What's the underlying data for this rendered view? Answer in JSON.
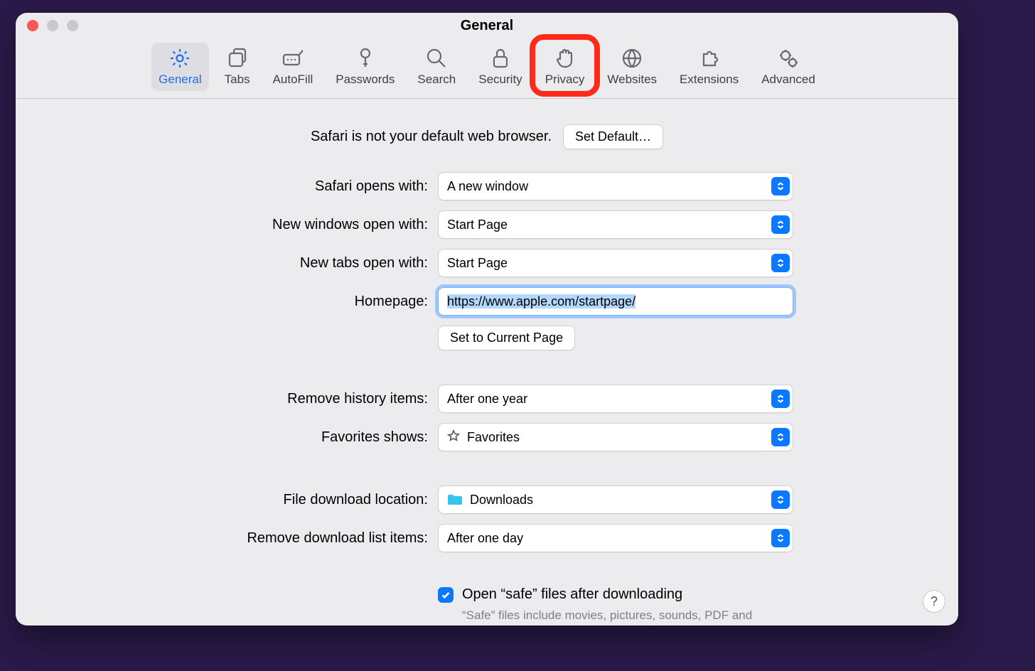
{
  "window": {
    "title": "General"
  },
  "tabs": [
    {
      "id": "general",
      "label": "General"
    },
    {
      "id": "tabs",
      "label": "Tabs"
    },
    {
      "id": "autofill",
      "label": "AutoFill"
    },
    {
      "id": "passwords",
      "label": "Passwords"
    },
    {
      "id": "search",
      "label": "Search"
    },
    {
      "id": "security",
      "label": "Security"
    },
    {
      "id": "privacy",
      "label": "Privacy"
    },
    {
      "id": "websites",
      "label": "Websites"
    },
    {
      "id": "extensions",
      "label": "Extensions"
    },
    {
      "id": "advanced",
      "label": "Advanced"
    }
  ],
  "active_tab": "general",
  "highlighted_tab": "privacy",
  "default_browser": {
    "text": "Safari is not your default web browser.",
    "button": "Set Default…"
  },
  "rows": {
    "opens_with": {
      "label": "Safari opens with:",
      "value": "A new window"
    },
    "new_windows": {
      "label": "New windows open with:",
      "value": "Start Page"
    },
    "new_tabs": {
      "label": "New tabs open with:",
      "value": "Start Page"
    },
    "homepage": {
      "label": "Homepage:",
      "value": "https://www.apple.com/startpage/"
    },
    "set_current": {
      "button": "Set to Current Page"
    },
    "remove_history": {
      "label": "Remove history items:",
      "value": "After one year"
    },
    "favorites": {
      "label": "Favorites shows:",
      "value": "Favorites"
    },
    "download_loc": {
      "label": "File download location:",
      "value": "Downloads"
    },
    "remove_downloads": {
      "label": "Remove download list items:",
      "value": "After one day"
    },
    "open_safe": {
      "label": "Open “safe” files after downloading",
      "checked": true,
      "desc": "“Safe” files include movies, pictures, sounds, PDF and text documents, and archives."
    }
  },
  "help": "?"
}
